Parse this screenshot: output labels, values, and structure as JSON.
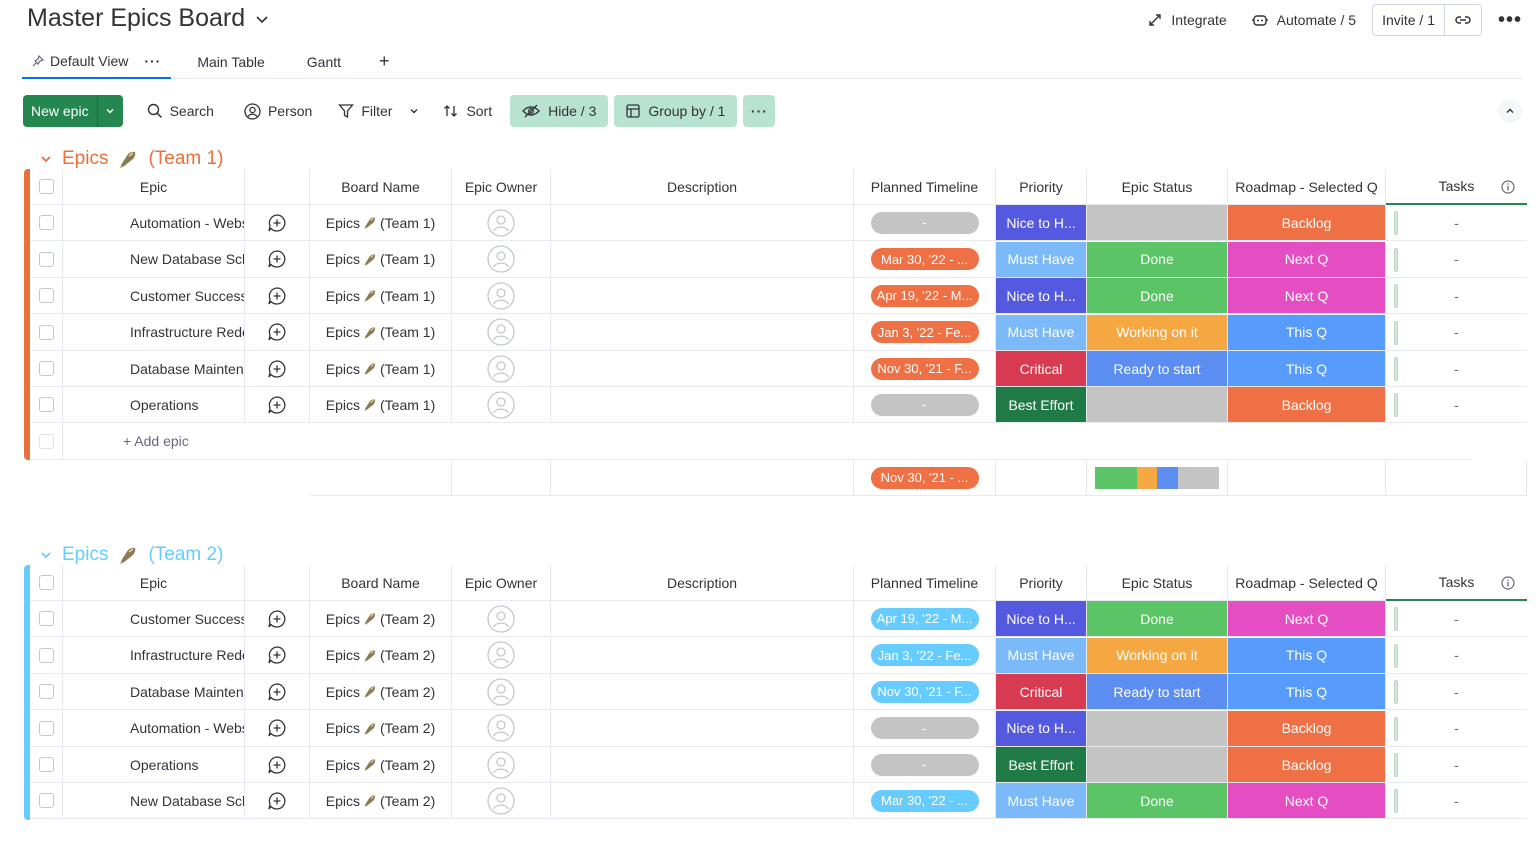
{
  "header": {
    "title": "Master Epics Board",
    "integrate": "Integrate",
    "automate": "Automate / 5",
    "invite": "Invite / 1"
  },
  "views": [
    {
      "label": "Default View",
      "active": true
    },
    {
      "label": "Main Table"
    },
    {
      "label": "Gantt"
    }
  ],
  "view_add": "+",
  "toolbar": {
    "new_item": "New epic",
    "search": "Search",
    "person": "Person",
    "filter": "Filter",
    "sort": "Sort",
    "hide": "Hide / 3",
    "group_by": "Group by / 1"
  },
  "columns": {
    "epic": "Epic",
    "board": "Board Name",
    "owner": "Epic Owner",
    "description": "Description",
    "timeline": "Planned Timeline",
    "priority": "Priority",
    "status": "Epic Status",
    "roadmap": "Roadmap - Selected Q",
    "tasks": "Tasks"
  },
  "colors": {
    "team1": "#e8703a",
    "team2": "#66ccff",
    "nice_to_have": "#5559df",
    "must_have": "#7cb9f8",
    "critical": "#d83a52",
    "best_effort": "#1f7a45",
    "done": "#5ac466",
    "working": "#f5a742",
    "ready": "#5b8ef0",
    "empty": "#c4c4c4",
    "backlog": "#ee7044",
    "next_q": "#e54ec2",
    "this_q": "#579bfc"
  },
  "groups": [
    {
      "title": "Epics",
      "suffix": "(Team 1)",
      "color": "#e8703a",
      "add_label": "+ Add epic",
      "summary_timeline": "Nov 30, '21 - ...",
      "rows": [
        {
          "name": "Automation - Websi...",
          "board": "Epics",
          "board_suffix": "(Team 1)",
          "timeline": "-",
          "timeline_color": "#c4c4c4",
          "priority": "Nice to H...",
          "priority_color": "#5559df",
          "status": "",
          "status_color": "#c4c4c4",
          "roadmap": "Backlog",
          "roadmap_color": "#ee7044",
          "tasks": "-"
        },
        {
          "name": "New Database Sche...",
          "board": "Epics",
          "board_suffix": "(Team 1)",
          "timeline": "Mar 30, '22 - ...",
          "timeline_color": "#ee7044",
          "priority": "Must Have",
          "priority_color": "#7cb9f8",
          "status": "Done",
          "status_color": "#5ac466",
          "roadmap": "Next Q",
          "roadmap_color": "#e54ec2",
          "tasks": "-"
        },
        {
          "name": "Customer Success ...",
          "board": "Epics",
          "board_suffix": "(Team 1)",
          "timeline": "Apr 19, '22 - M...",
          "timeline_color": "#ee7044",
          "priority": "Nice to H...",
          "priority_color": "#5559df",
          "status": "Done",
          "status_color": "#5ac466",
          "roadmap": "Next Q",
          "roadmap_color": "#e54ec2",
          "tasks": "-"
        },
        {
          "name": "Infrastructure Rede...",
          "board": "Epics",
          "board_suffix": "(Team 1)",
          "timeline": "Jan 3, '22 - Fe...",
          "timeline_color": "#ee7044",
          "priority": "Must Have",
          "priority_color": "#7cb9f8",
          "status": "Working on it",
          "status_color": "#f5a742",
          "roadmap": "This Q",
          "roadmap_color": "#579bfc",
          "tasks": "-"
        },
        {
          "name": "Database Maintena...",
          "board": "Epics",
          "board_suffix": "(Team 1)",
          "timeline": "Nov 30, '21 - F...",
          "timeline_color": "#ee7044",
          "priority": "Critical",
          "priority_color": "#d83a52",
          "status": "Ready to start",
          "status_color": "#5b8ef0",
          "roadmap": "This Q",
          "roadmap_color": "#579bfc",
          "tasks": "-"
        },
        {
          "name": "Operations",
          "board": "Epics",
          "board_suffix": "(Team 1)",
          "timeline": "-",
          "timeline_color": "#c4c4c4",
          "priority": "Best Effort",
          "priority_color": "#1f7a45",
          "status": "",
          "status_color": "#c4c4c4",
          "roadmap": "Backlog",
          "roadmap_color": "#ee7044",
          "tasks": "-"
        }
      ]
    },
    {
      "title": "Epics",
      "suffix": "(Team 2)",
      "color": "#66ccff",
      "rows": [
        {
          "name": "Customer Success ...",
          "board": "Epics",
          "board_suffix": "(Team 2)",
          "timeline": "Apr 19, '22 - M...",
          "timeline_color": "#66ccff",
          "priority": "Nice to H...",
          "priority_color": "#5559df",
          "status": "Done",
          "status_color": "#5ac466",
          "roadmap": "Next Q",
          "roadmap_color": "#e54ec2",
          "tasks": "-"
        },
        {
          "name": "Infrastructure Rede...",
          "board": "Epics",
          "board_suffix": "(Team 2)",
          "timeline": "Jan 3, '22 - Fe...",
          "timeline_color": "#66ccff",
          "priority": "Must Have",
          "priority_color": "#7cb9f8",
          "status": "Working on it",
          "status_color": "#f5a742",
          "roadmap": "This Q",
          "roadmap_color": "#579bfc",
          "tasks": "-"
        },
        {
          "name": "Database Maintena...",
          "board": "Epics",
          "board_suffix": "(Team 2)",
          "timeline": "Nov 30, '21 - F...",
          "timeline_color": "#66ccff",
          "priority": "Critical",
          "priority_color": "#d83a52",
          "status": "Ready to start",
          "status_color": "#5b8ef0",
          "roadmap": "This Q",
          "roadmap_color": "#579bfc",
          "tasks": "-"
        },
        {
          "name": "Automation - Websi...",
          "board": "Epics",
          "board_suffix": "(Team 2)",
          "timeline": "-",
          "timeline_color": "#c4c4c4",
          "priority": "Nice to H...",
          "priority_color": "#5559df",
          "status": "",
          "status_color": "#c4c4c4",
          "roadmap": "Backlog",
          "roadmap_color": "#ee7044",
          "tasks": "-"
        },
        {
          "name": "Operations",
          "board": "Epics",
          "board_suffix": "(Team 2)",
          "timeline": "-",
          "timeline_color": "#c4c4c4",
          "priority": "Best Effort",
          "priority_color": "#1f7a45",
          "status": "",
          "status_color": "#c4c4c4",
          "roadmap": "Backlog",
          "roadmap_color": "#ee7044",
          "tasks": "-"
        },
        {
          "name": "New Database Sche...",
          "board": "Epics",
          "board_suffix": "(Team 2)",
          "timeline": "Mar 30, '22 - ...",
          "timeline_color": "#66ccff",
          "priority": "Must Have",
          "priority_color": "#7cb9f8",
          "status": "Done",
          "status_color": "#5ac466",
          "roadmap": "Next Q",
          "roadmap_color": "#e54ec2",
          "tasks": "-"
        }
      ]
    }
  ]
}
